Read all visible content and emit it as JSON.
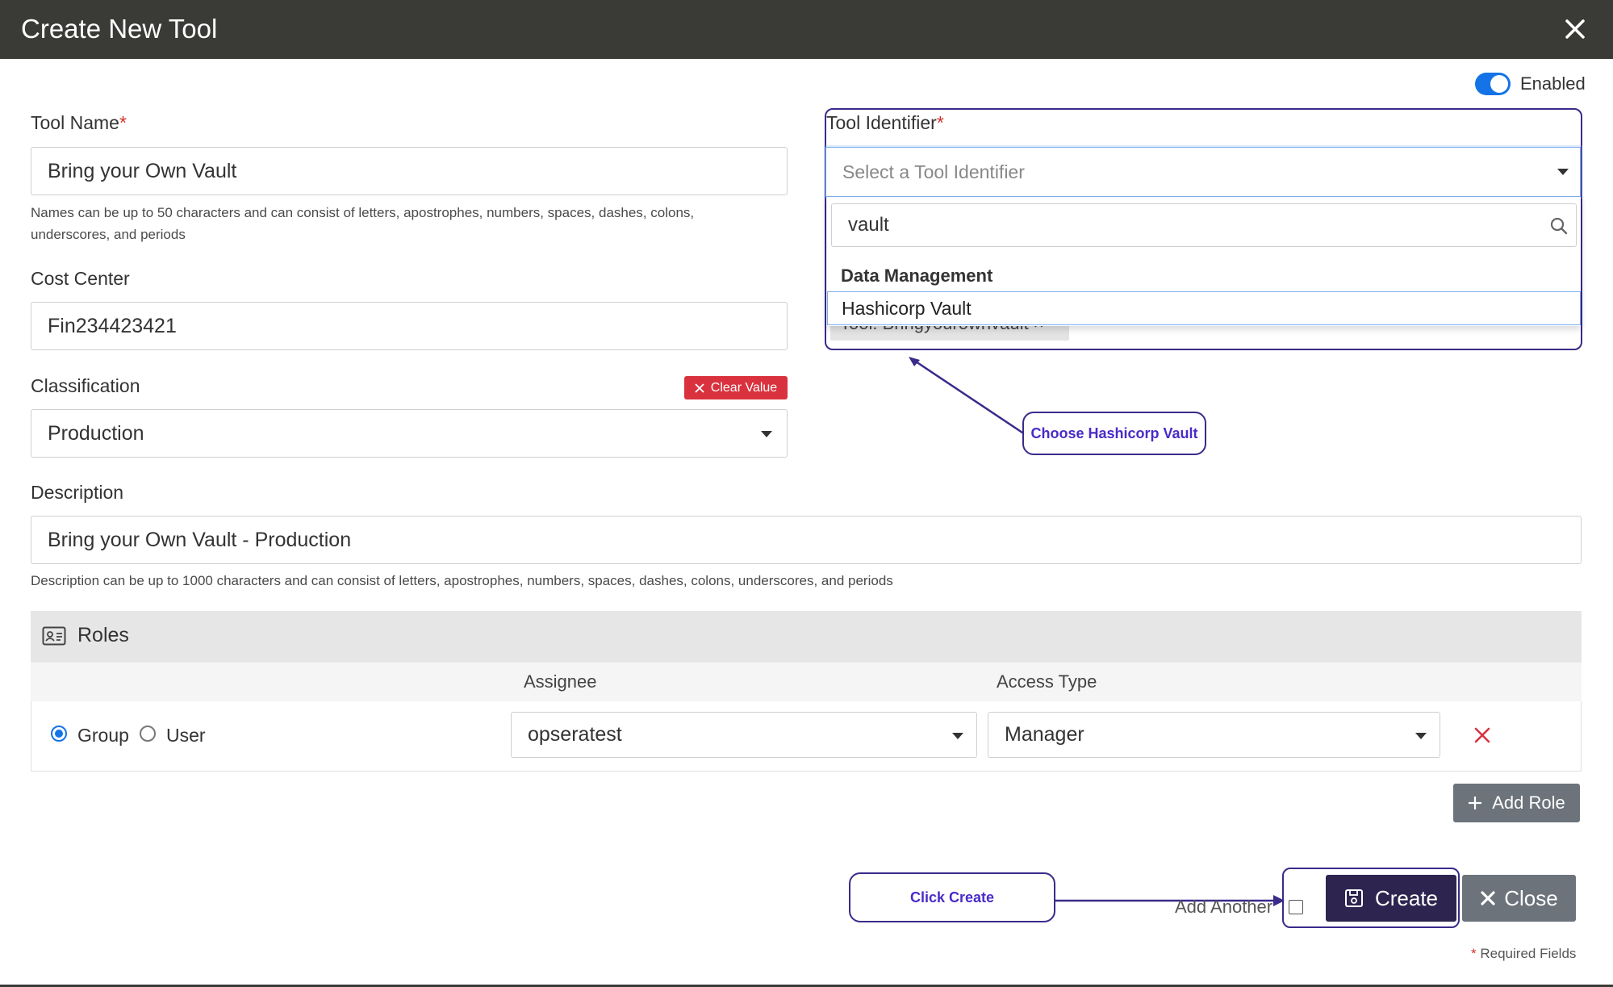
{
  "header": {
    "title": "Create New Tool"
  },
  "enabled": {
    "label": "Enabled",
    "on": true
  },
  "tool_name": {
    "label": "Tool Name",
    "required_mark": "*",
    "value": "Bring your Own Vault",
    "help_line1": "Names can be up to 50 characters and can consist of letters, apostrophes, numbers, spaces, dashes, colons,",
    "help_line2": "underscores, and periods"
  },
  "cost_center": {
    "label": "Cost Center",
    "value": "Fin234423421"
  },
  "classification": {
    "label": "Classification",
    "value": "Production",
    "clear_label": "Clear Value"
  },
  "tool_identifier": {
    "label": "Tool Identifier",
    "required_mark": "*",
    "placeholder": "Select a Tool Identifier",
    "search_value": "vault",
    "group": "Data Management",
    "option": "Hashicorp Vault",
    "tag_chip": "Tool: Bringyourownvault"
  },
  "description": {
    "label": "Description",
    "value": "Bring your Own Vault - Production",
    "help": "Description can be up to 1000 characters and can consist of letters, apostrophes, numbers, spaces, dashes, colons, underscores, and periods"
  },
  "roles": {
    "title": "Roles",
    "columns": {
      "assignee": "Assignee",
      "access_type": "Access Type"
    },
    "row": {
      "group_label": "Group",
      "user_label": "User",
      "selected": "Group",
      "assignee": "opseratest",
      "access_type": "Manager"
    },
    "add_label": "Add Role"
  },
  "footer": {
    "add_another": "Add Another",
    "create_label": "Create",
    "close_label": "Close",
    "required_note": "Required Fields",
    "required_mark": "*"
  },
  "annotations": {
    "choose_vault": "Choose Hashicorp Vault",
    "click_create": "Click Create"
  },
  "colors": {
    "header": "#3a3a37",
    "accent": "#1473e6",
    "danger": "#d9323e",
    "callout": "#3a2a8a",
    "create_button": "#2d2550"
  }
}
